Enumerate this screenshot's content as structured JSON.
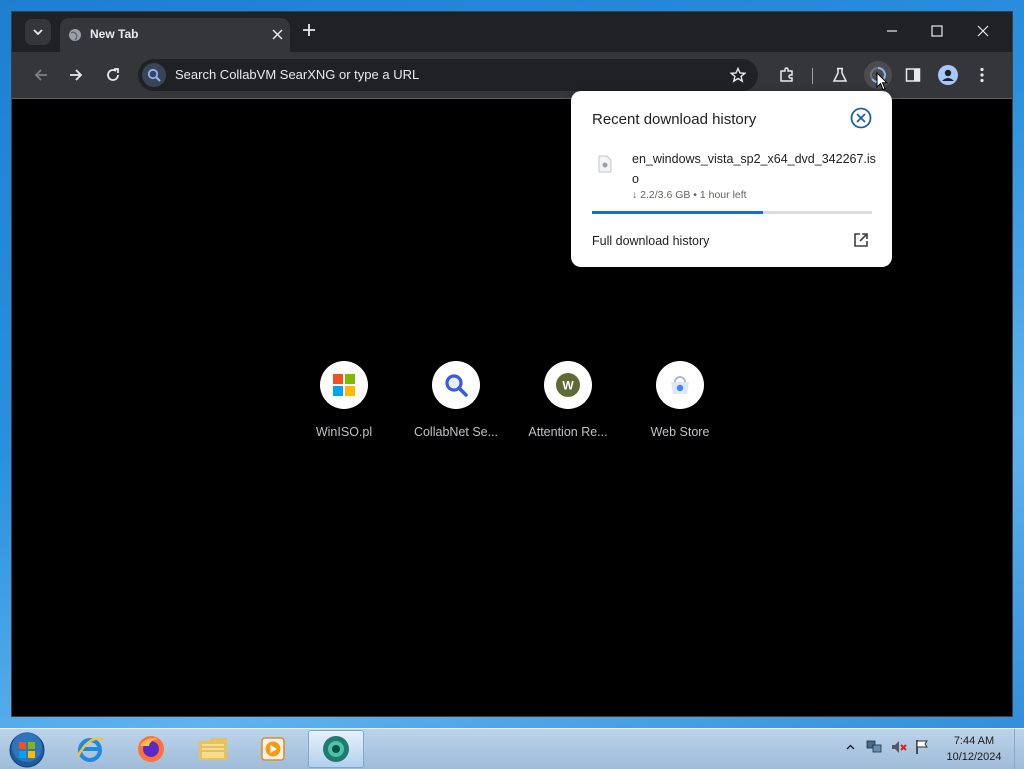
{
  "browser": {
    "tab_title": "New Tab",
    "omnibox_placeholder": "Search CollabVM SearXNG or type a URL"
  },
  "shortcuts": [
    {
      "label": "WinISO.pl",
      "icon": "windows-logo-icon"
    },
    {
      "label": "CollabNet Se...",
      "icon": "magnifier-icon"
    },
    {
      "label": "Attention Re...",
      "icon": "letter-w-icon",
      "letter": "W"
    },
    {
      "label": "Web Store",
      "icon": "web-store-icon"
    }
  ],
  "download_bubble": {
    "title": "Recent download history",
    "file_name": "en_windows_vista_sp2_x64_dvd_342267.iso",
    "status": "↓ 2.2/3.6 GB • 1 hour left",
    "progress_fraction": 0.61,
    "full_history_label": "Full download history"
  },
  "taskbar": {
    "apps": [
      "internet-explorer-icon",
      "firefox-icon",
      "file-explorer-icon",
      "media-player-icon",
      "browser-active-icon"
    ],
    "clock_time": "7:44 AM",
    "clock_date": "10/12/2024"
  },
  "colors": {
    "accent": "#1a6cd1",
    "window_bg": "#202124",
    "toolbar_bg": "#35363a"
  }
}
